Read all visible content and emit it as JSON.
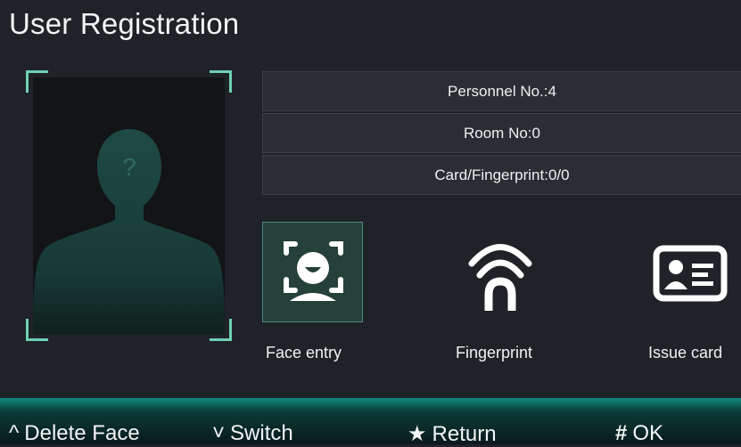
{
  "title": "User Registration",
  "photo": {
    "placeholder_icon": "unknown-person-silhouette"
  },
  "info": {
    "personnel": "Personnel No.:4",
    "room": "Room No:0",
    "card_fp": "Card/Fingerprint:0/0"
  },
  "functions": [
    {
      "label": "Face entry",
      "icon": "face-scan-icon",
      "selected": true
    },
    {
      "label": "Fingerprint",
      "icon": "fingerprint-wave-icon",
      "selected": false
    },
    {
      "label": "Issue card",
      "icon": "id-card-icon",
      "selected": false
    }
  ],
  "footer": {
    "delete_face": "Delete Face",
    "switch": "Switch",
    "return": "Return",
    "ok": "OK",
    "up_glyph": "^",
    "down_glyph": "˅",
    "star_glyph": "★",
    "hash_glyph": "#"
  },
  "colors": {
    "accent": "#6fd0b4",
    "background": "#1f2226",
    "footer": "#0f8a7d"
  }
}
